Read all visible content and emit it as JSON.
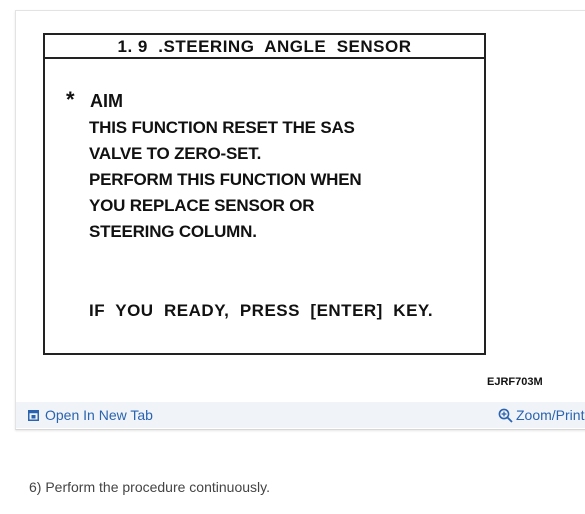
{
  "figure": {
    "screen": {
      "title": "1. 9  .STEERING  ANGLE  SENSOR",
      "aim_star": "*",
      "aim_label": "AIM",
      "body_lines": [
        "THIS FUNCTION RESET THE SAS",
        "VALVE TO ZERO-SET.",
        "PERFORM THIS FUNCTION WHEN",
        "YOU REPLACE SENSOR OR",
        "STEERING COLUMN."
      ],
      "prompt": "IF  YOU  READY,  PRESS  [ENTER]  KEY."
    },
    "code": "EJRF703M",
    "toolbar": {
      "open_tab_label": "Open In New Tab",
      "open_tab_icon": "open-in-new-tab-icon",
      "zoom_label": "Zoom/Print",
      "zoom_icon": "zoom-in-icon"
    }
  },
  "step_text": "6) Perform the procedure continuously.",
  "colors": {
    "link": "#2a63b0",
    "toolbar_bg": "#f0f4f8"
  }
}
